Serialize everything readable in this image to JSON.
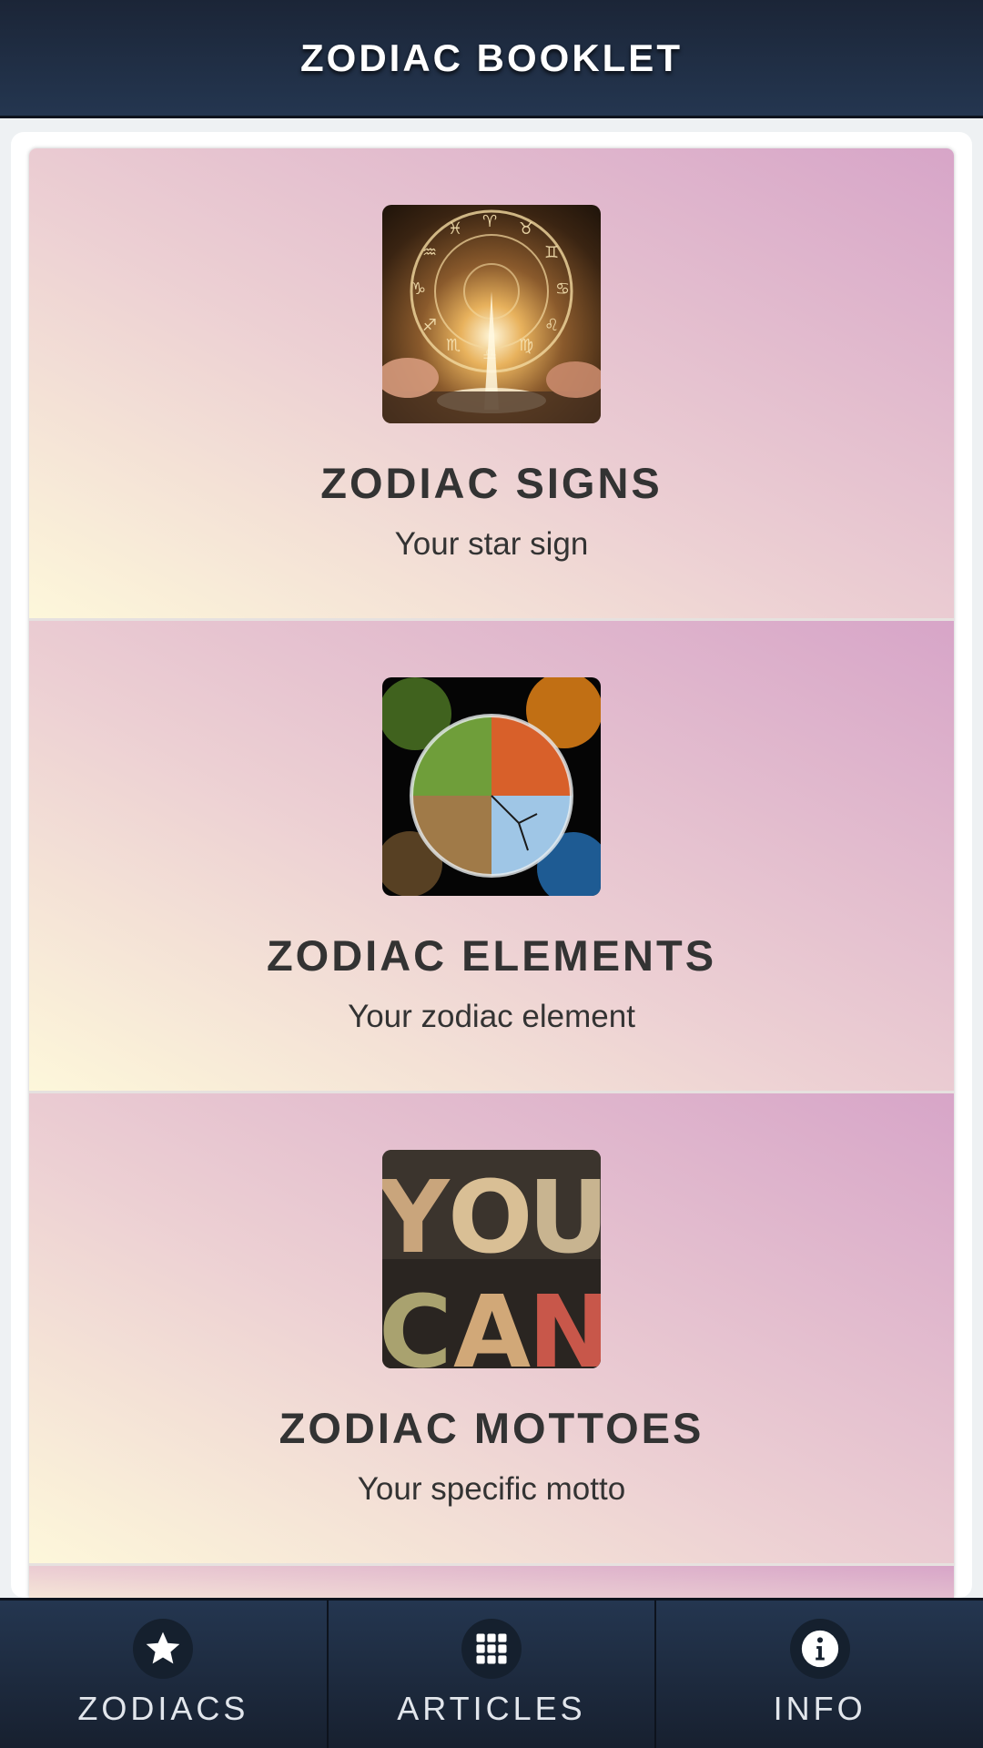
{
  "header": {
    "title": "ZODIAC BOOKLET"
  },
  "cards": [
    {
      "title": "ZODIAC SIGNS",
      "subtitle": "Your star sign",
      "image": "zodiac-wheel-book-image"
    },
    {
      "title": "ZODIAC ELEMENTS",
      "subtitle": "Your zodiac element",
      "image": "four-elements-globe-image"
    },
    {
      "title": "ZODIAC MOTTOES",
      "subtitle": "Your specific motto",
      "image": "you-can-letterpress-image"
    }
  ],
  "bottom_nav": {
    "items": [
      {
        "label": "ZODIACS",
        "icon": "star-icon"
      },
      {
        "label": "ARTICLES",
        "icon": "grid-icon"
      },
      {
        "label": "INFO",
        "icon": "info-icon"
      }
    ]
  },
  "colors": {
    "header_bg": "#1f2d44",
    "card_gradient_top": "#d7a5c8",
    "card_gradient_bottom": "#fdf7da",
    "text": "#333333"
  }
}
